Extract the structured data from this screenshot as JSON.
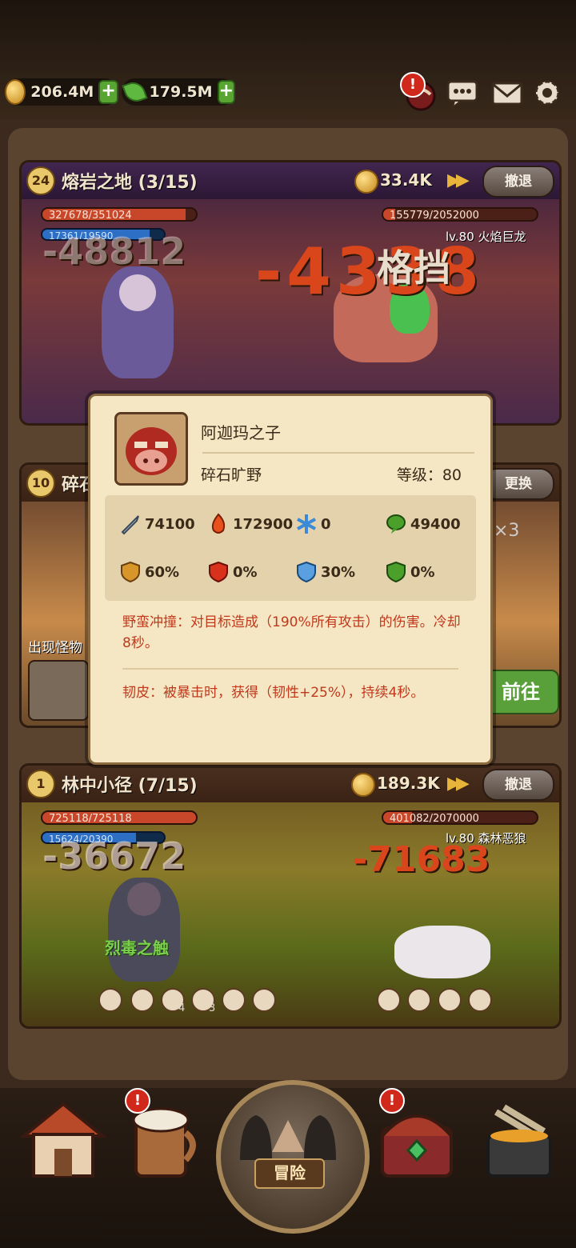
{
  "resources": {
    "gold": "206.4M",
    "gems": "179.5M"
  },
  "battles": [
    {
      "level": "24",
      "title": "熔岩之地 (3/15)",
      "gold": "33.4K",
      "retreat": "撤退",
      "hero_hp": "327678/351024",
      "hero_mp": "17361/19590",
      "monster_hp": "155779/2052000",
      "monster_name": "lv.80 火焰巨龙",
      "hero_damage": "-48812",
      "monster_damage": "-4338",
      "block_text": "格挡"
    },
    {
      "level": "10",
      "title": "碎石",
      "change": "更换",
      "multiplier": "×3",
      "appear_label": "出现怪物",
      "goto": "前往"
    },
    {
      "level": "1",
      "title": "林中小径 (7/15)",
      "gold": "189.3K",
      "retreat": "撤退",
      "hero_hp": "725118/725118",
      "hero_mp": "15624/20390",
      "monster_hp": "401082/2070000",
      "monster_name": "lv.80 森林恶狼",
      "hero_damage": "-36672",
      "monster_damage": "-71683",
      "skill_text": "烈毒之触",
      "slot_count_a": "4",
      "slot_count_b": "3"
    }
  ],
  "popup": {
    "name": "阿迦玛之子",
    "area": "碎石旷野",
    "level_label": "等级：80",
    "stats": {
      "attack": "74100",
      "fire": "172900",
      "ice": "0",
      "poison": "49400",
      "phys_resist": "60%",
      "fire_resist": "0%",
      "ice_resist": "30%",
      "poison_resist": "0%"
    },
    "skill1": "野蛮冲撞：对目标造成（190%所有攻击）的伤害。冷却8秒。",
    "skill2": "韧皮：被暴击时，获得（韧性+25%），持续4秒。"
  },
  "nav": {
    "adventure": "冒险"
  },
  "colors": {
    "damage": "#d9461c",
    "skill_text": "#c0391c",
    "panel_head": "#41264f"
  }
}
